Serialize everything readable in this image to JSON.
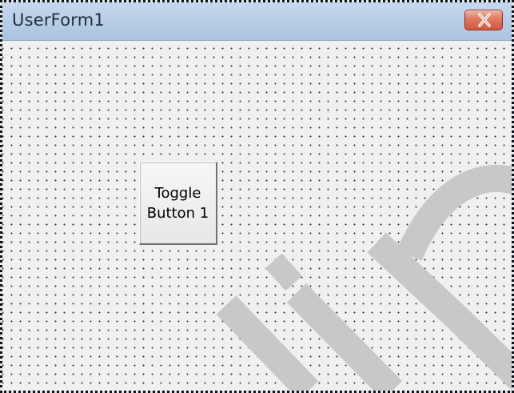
{
  "window": {
    "title": "UserForm1",
    "close_button_label": ""
  },
  "form": {
    "toggle_button_label": "Toggle Button 1"
  },
  "icons": {
    "close": "close-icon"
  },
  "colors": {
    "titlebar": "#b7cde6",
    "form_background": "#f0f0f0",
    "grid_dots": "#2b2b2b",
    "close_button": "#d96a4f",
    "watermark": "#c8c8c8"
  }
}
